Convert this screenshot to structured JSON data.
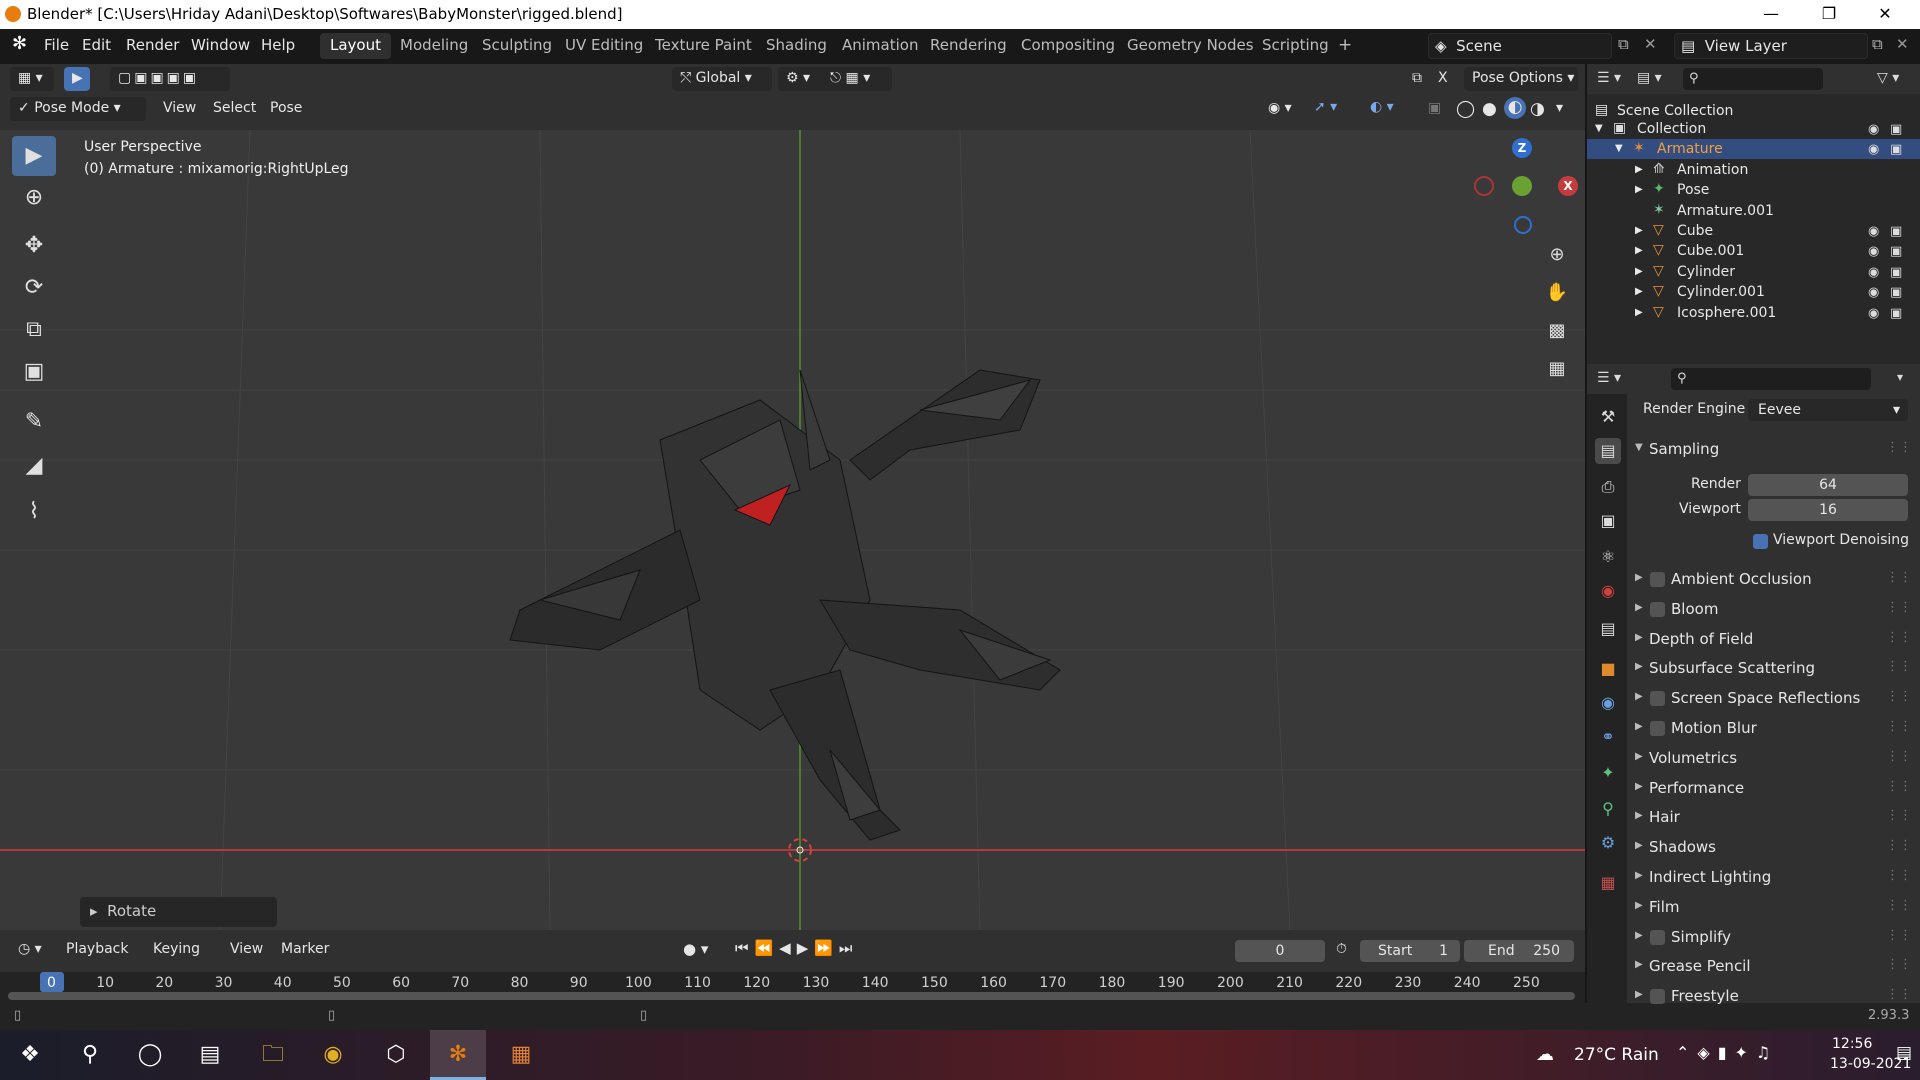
{
  "window": {
    "title": "Blender* [C:\\Users\\Hriday Adani\\Desktop\\Softwares\\BabyMonster\\rigged.blend]"
  },
  "menubar": {
    "items": [
      "File",
      "Edit",
      "Render",
      "Window",
      "Help"
    ]
  },
  "workspaces": {
    "tabs": [
      "Layout",
      "Modeling",
      "Sculpting",
      "UV Editing",
      "Texture Paint",
      "Shading",
      "Animation",
      "Rendering",
      "Compositing",
      "Geometry Nodes",
      "Scripting"
    ],
    "active": "Layout"
  },
  "scene": {
    "name": "Scene",
    "view_layer": "View Layer"
  },
  "viewport_header": {
    "transform_orientation": "Global",
    "pose_options": "Pose Options",
    "mode": "Pose Mode",
    "menus": [
      "View",
      "Select",
      "Pose"
    ]
  },
  "viewport": {
    "perspective_label": "User Perspective",
    "active_object_label": "(0) Armature : mixamorig:RightUpLeg",
    "gizmo_axes": [
      "Z",
      "X"
    ],
    "last_op_panel": "Rotate"
  },
  "timeline": {
    "menus": [
      "Playback",
      "Keying",
      "View",
      "Marker"
    ],
    "current_frame": "0",
    "start_label": "Start",
    "start": "1",
    "end_label": "End",
    "end": "250",
    "ruler": [
      "0",
      "10",
      "20",
      "30",
      "40",
      "50",
      "60",
      "70",
      "80",
      "90",
      "100",
      "110",
      "120",
      "130",
      "140",
      "150",
      "160",
      "170",
      "180",
      "190",
      "200",
      "210",
      "220",
      "230",
      "240",
      "250"
    ]
  },
  "outliner": {
    "root": "Scene Collection",
    "items": [
      {
        "label": "Collection",
        "icon": "collection-icon",
        "level": 0,
        "selected": false
      },
      {
        "label": "Armature",
        "icon": "armature-icon",
        "level": 1,
        "selected": true
      },
      {
        "label": "Animation",
        "icon": "animation-icon",
        "level": 2,
        "selected": false
      },
      {
        "label": "Pose",
        "icon": "pose-icon",
        "level": 2,
        "selected": false
      },
      {
        "label": "Armature.001",
        "icon": "armature-data-icon",
        "level": 2,
        "selected": false
      },
      {
        "label": "Cube",
        "icon": "mesh-icon",
        "level": 2,
        "selected": false
      },
      {
        "label": "Cube.001",
        "icon": "mesh-icon",
        "level": 2,
        "selected": false
      },
      {
        "label": "Cylinder",
        "icon": "mesh-icon",
        "level": 2,
        "selected": false
      },
      {
        "label": "Cylinder.001",
        "icon": "mesh-icon",
        "level": 2,
        "selected": false
      },
      {
        "label": "Icosphere.001",
        "icon": "mesh-icon",
        "level": 2,
        "selected": false
      }
    ]
  },
  "properties": {
    "render_engine_label": "Render Engine",
    "render_engine": "Eevee",
    "sampling_label": "Sampling",
    "render_label": "Render",
    "render_samples": "64",
    "viewport_label": "Viewport",
    "viewport_samples": "16",
    "viewport_denoising": "Viewport Denoising",
    "panels": [
      {
        "label": "Ambient Occlusion",
        "checkbox": true
      },
      {
        "label": "Bloom",
        "checkbox": true
      },
      {
        "label": "Depth of Field",
        "checkbox": false
      },
      {
        "label": "Subsurface Scattering",
        "checkbox": false
      },
      {
        "label": "Screen Space Reflections",
        "checkbox": true
      },
      {
        "label": "Motion Blur",
        "checkbox": true
      },
      {
        "label": "Volumetrics",
        "checkbox": false
      },
      {
        "label": "Performance",
        "checkbox": false
      },
      {
        "label": "Hair",
        "checkbox": false
      },
      {
        "label": "Shadows",
        "checkbox": false
      },
      {
        "label": "Indirect Lighting",
        "checkbox": false
      },
      {
        "label": "Film",
        "checkbox": false
      },
      {
        "label": "Simplify",
        "checkbox": true
      },
      {
        "label": "Grease Pencil",
        "checkbox": false
      },
      {
        "label": "Freestyle",
        "checkbox": true
      }
    ]
  },
  "statusbar": {
    "version": "2.93.3"
  },
  "taskbar": {
    "weather": "27°C Rain",
    "time": "12:56",
    "date": "13-09-2021"
  },
  "colors": {
    "accent_blue": "#4772b3",
    "selection": "#334d80",
    "blender_orange": "#e87d0d",
    "x_axis": "#c43c3c",
    "z_axis": "#2f6fd0",
    "y_axis": "#6aa232"
  }
}
